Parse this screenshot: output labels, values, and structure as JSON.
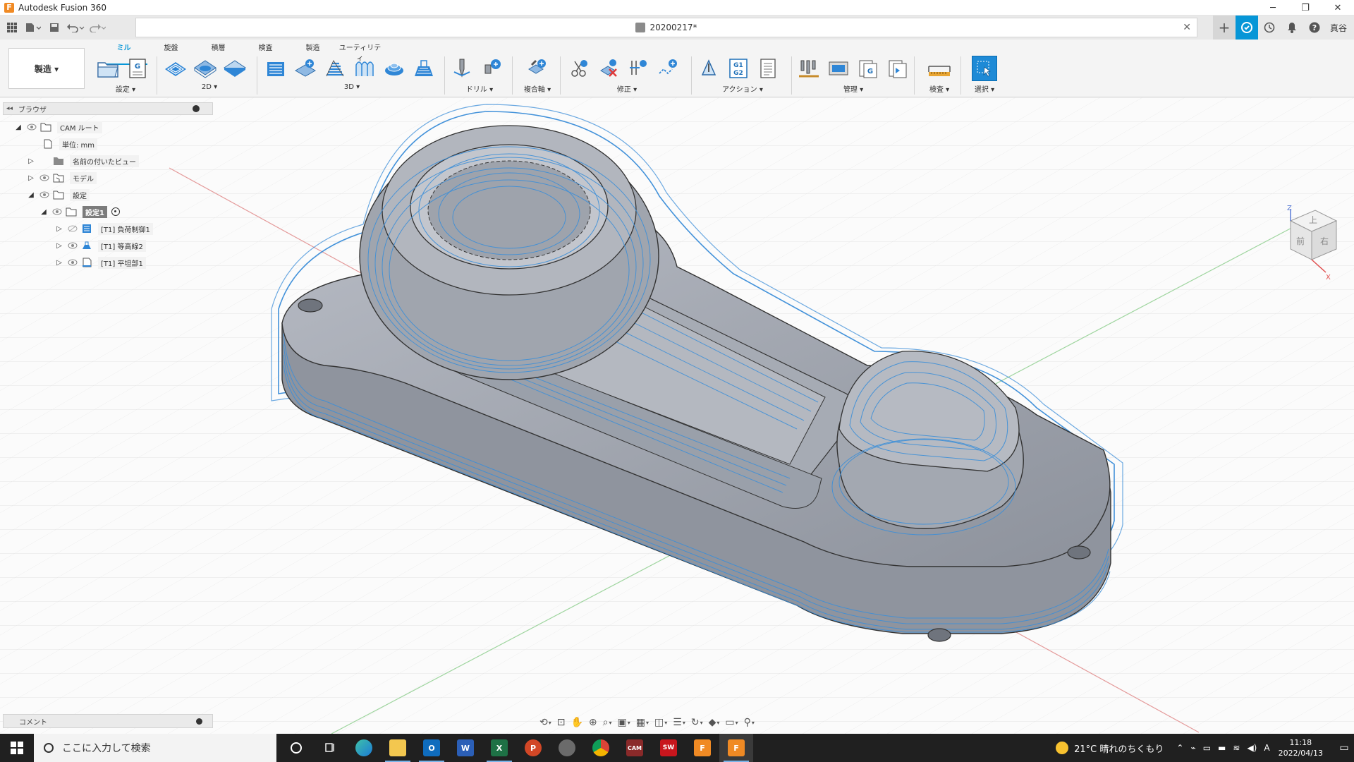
{
  "window": {
    "app_title": "Autodesk Fusion 360",
    "logo_letter": "F",
    "minimize": "─",
    "restore": "❐",
    "close": "✕"
  },
  "quickaccess": {
    "document_title": "20200217*",
    "close_tab": "✕",
    "user": "真谷"
  },
  "ribbon": {
    "tabs": [
      "ミル",
      "旋盤",
      "積層",
      "検査",
      "製造",
      "ユーティリティ"
    ],
    "active_tab": "ミル",
    "workspace": "製造 ▾",
    "groups": [
      "設定 ▾",
      "2D ▾",
      "3D ▾",
      "ドリル ▾",
      "複合軸 ▾",
      "修正 ▾",
      "アクション ▾",
      "管理 ▾",
      "検査 ▾",
      "選択 ▾"
    ]
  },
  "browser": {
    "title": "ブラウザ",
    "items": [
      {
        "label": "CAM ルート"
      },
      {
        "label": "単位: mm"
      },
      {
        "label": "名前の付いたビュー"
      },
      {
        "label": "モデル"
      },
      {
        "label": "設定"
      },
      {
        "label": "設定1"
      },
      {
        "label": "[T1] 負荷制御1"
      },
      {
        "label": "[T1] 等高線2"
      },
      {
        "label": "[T1] 平坦部1"
      }
    ]
  },
  "viewcube": {
    "top": "上",
    "front": "前",
    "right": "右",
    "axis_z": "Z",
    "axis_x": "X"
  },
  "comment": {
    "label": "コメント"
  },
  "taskbar": {
    "search_placeholder": "ここに入力して検索",
    "weather": "21°C 晴れのちくもり",
    "time": "11:18",
    "date": "2022/04/13",
    "ime": "A",
    "apps": [
      "Edge",
      "Explorer",
      "Outlook",
      "Word",
      "Excel",
      "PowerPoint",
      "App",
      "Chrome",
      "CAM",
      "SolidWorks 2021",
      "Fusion",
      "Fusion"
    ]
  },
  "colors": {
    "accent": "#0696d7",
    "toolpath": "#2f86d6",
    "part": "#9ea3ad"
  }
}
